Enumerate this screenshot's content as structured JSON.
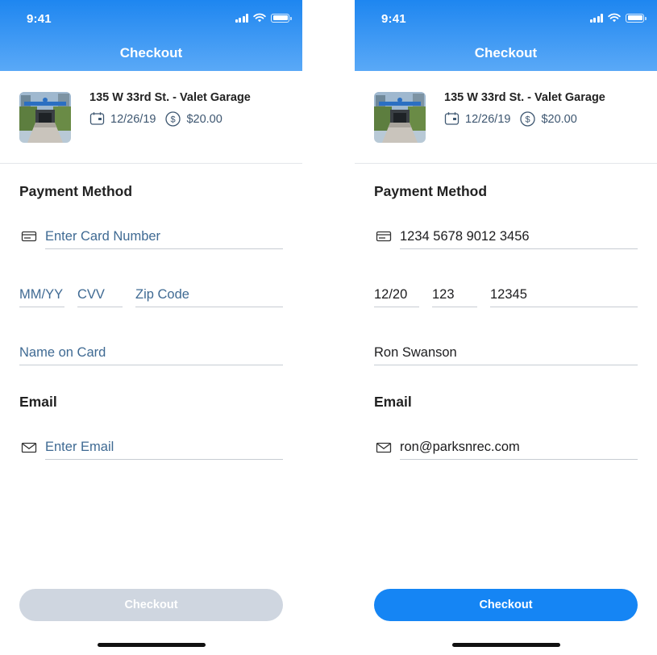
{
  "status_bar": {
    "time": "9:41"
  },
  "screens": [
    {
      "state": "empty",
      "header": {
        "title": "Checkout"
      },
      "summary": {
        "location": "135 W 33rd St. - Valet Garage",
        "date": "12/26/19",
        "price": "$20.00"
      },
      "payment": {
        "heading": "Payment Method",
        "card_number": {
          "placeholder": "Enter Card Number",
          "value": ""
        },
        "expiry": {
          "placeholder": "MM/YY",
          "value": ""
        },
        "cvv": {
          "placeholder": "CVV",
          "value": ""
        },
        "zip": {
          "placeholder": "Zip Code",
          "value": ""
        },
        "name": {
          "placeholder": "Name on Card",
          "value": ""
        }
      },
      "email": {
        "heading": "Email",
        "field": {
          "placeholder": "Enter Email",
          "value": ""
        }
      },
      "checkout_button": {
        "label": "Checkout",
        "enabled": false
      }
    },
    {
      "state": "filled",
      "header": {
        "title": "Checkout"
      },
      "summary": {
        "location": "135 W 33rd St. - Valet Garage",
        "date": "12/26/19",
        "price": "$20.00"
      },
      "payment": {
        "heading": "Payment Method",
        "card_number": {
          "placeholder": "Enter Card Number",
          "value": "1234 5678 9012 3456"
        },
        "expiry": {
          "placeholder": "MM/YY",
          "value": "12/20"
        },
        "cvv": {
          "placeholder": "CVV",
          "value": "123"
        },
        "zip": {
          "placeholder": "Zip Code",
          "value": "12345"
        },
        "name": {
          "placeholder": "Name on Card",
          "value": "Ron Swanson"
        }
      },
      "email": {
        "heading": "Email",
        "field": {
          "placeholder": "Enter Email",
          "value": "ron@parksnrec.com"
        }
      },
      "checkout_button": {
        "label": "Checkout",
        "enabled": true
      }
    }
  ],
  "icons": {
    "calendar": "calendar-icon",
    "dollar": "dollar-icon",
    "card": "credit-card-icon",
    "email": "envelope-icon"
  },
  "colors": {
    "header_gradient_top": "#1e86f0",
    "header_gradient_bottom": "#5aa9f7",
    "button_enabled": "#1585f4",
    "button_disabled": "#cfd6e0",
    "placeholder_text": "#3f6a93"
  }
}
